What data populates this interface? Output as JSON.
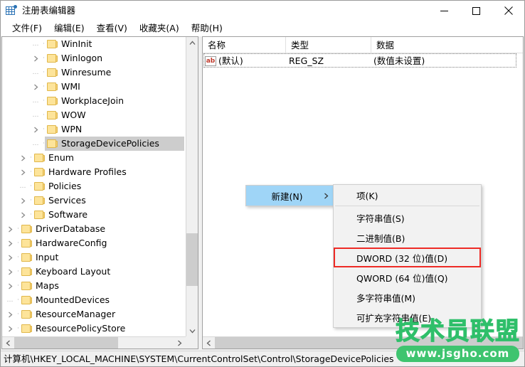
{
  "window": {
    "title": "注册表编辑器",
    "icon": "registry-icon",
    "controls": {
      "minimize": "minimize-icon",
      "maximize": "maximize-icon",
      "close": "close-icon"
    }
  },
  "menubar": {
    "items": [
      {
        "label": "文件(F)"
      },
      {
        "label": "编辑(E)"
      },
      {
        "label": "查看(V)"
      },
      {
        "label": "收藏夹(A)"
      },
      {
        "label": "帮助(H)"
      }
    ]
  },
  "tree": {
    "nodes": [
      {
        "label": "WinInit",
        "indent": 3,
        "expander": false,
        "selected": false
      },
      {
        "label": "Winlogon",
        "indent": 3,
        "expander": true,
        "selected": false
      },
      {
        "label": "Winresume",
        "indent": 3,
        "expander": false,
        "selected": false
      },
      {
        "label": "WMI",
        "indent": 3,
        "expander": true,
        "selected": false
      },
      {
        "label": "WorkplaceJoin",
        "indent": 3,
        "expander": false,
        "selected": false
      },
      {
        "label": "WOW",
        "indent": 3,
        "expander": false,
        "selected": false
      },
      {
        "label": "WPN",
        "indent": 3,
        "expander": true,
        "selected": false
      },
      {
        "label": "StorageDevicePolicies",
        "indent": 3,
        "expander": false,
        "selected": true
      },
      {
        "label": "Enum",
        "indent": 2,
        "expander": true,
        "selected": false
      },
      {
        "label": "Hardware Profiles",
        "indent": 2,
        "expander": true,
        "selected": false
      },
      {
        "label": "Policies",
        "indent": 2,
        "expander": false,
        "selected": false
      },
      {
        "label": "Services",
        "indent": 2,
        "expander": true,
        "selected": false
      },
      {
        "label": "Software",
        "indent": 2,
        "expander": true,
        "selected": false
      },
      {
        "label": "DriverDatabase",
        "indent": 1,
        "expander": true,
        "selected": false
      },
      {
        "label": "HardwareConfig",
        "indent": 1,
        "expander": true,
        "selected": false
      },
      {
        "label": "Input",
        "indent": 1,
        "expander": true,
        "selected": false
      },
      {
        "label": "Keyboard Layout",
        "indent": 1,
        "expander": true,
        "selected": false
      },
      {
        "label": "Maps",
        "indent": 1,
        "expander": true,
        "selected": false
      },
      {
        "label": "MountedDevices",
        "indent": 1,
        "expander": false,
        "selected": false
      },
      {
        "label": "ResourceManager",
        "indent": 1,
        "expander": true,
        "selected": false
      },
      {
        "label": "ResourcePolicyStore",
        "indent": 1,
        "expander": true,
        "selected": false
      }
    ]
  },
  "listview": {
    "columns": [
      {
        "label": "名称"
      },
      {
        "label": "类型"
      },
      {
        "label": "数据"
      }
    ],
    "rows": [
      {
        "icon": "string-value-icon",
        "name": "(默认)",
        "type": "REG_SZ",
        "data": "(数值未设置)"
      }
    ]
  },
  "context_menu": {
    "parent": {
      "label": "新建(N)",
      "submenu_arrow": "chevron-right-icon"
    },
    "submenu": {
      "items": [
        {
          "label": "项(K)",
          "highlighted": false,
          "separator_after": true
        },
        {
          "label": "字符串值(S)",
          "highlighted": false,
          "separator_after": false
        },
        {
          "label": "二进制值(B)",
          "highlighted": false,
          "separator_after": false
        },
        {
          "label": "DWORD (32 位)值(D)",
          "highlighted": true,
          "separator_after": false
        },
        {
          "label": "QWORD (64 位)值(Q)",
          "highlighted": false,
          "separator_after": false
        },
        {
          "label": "多字符串值(M)",
          "highlighted": false,
          "separator_after": false
        },
        {
          "label": "可扩充字符串值(E)",
          "highlighted": false,
          "separator_after": false
        }
      ]
    }
  },
  "statusbar": {
    "path": "计算机\\HKEY_LOCAL_MACHINE\\SYSTEM\\CurrentControlSet\\Control\\StorageDevicePolicies"
  },
  "watermark": {
    "main": "技术员联盟",
    "url": "www.jsgho.com"
  },
  "colors": {
    "menu_highlight": "#9fd5f7",
    "red_box": "#ee2b26",
    "tree_selection": "#cdcdcd",
    "folder_fill": "#fde49a",
    "folder_border": "#e0b74a",
    "watermark_green": "#3ec46f",
    "icon_blue": "#2a72b5"
  }
}
